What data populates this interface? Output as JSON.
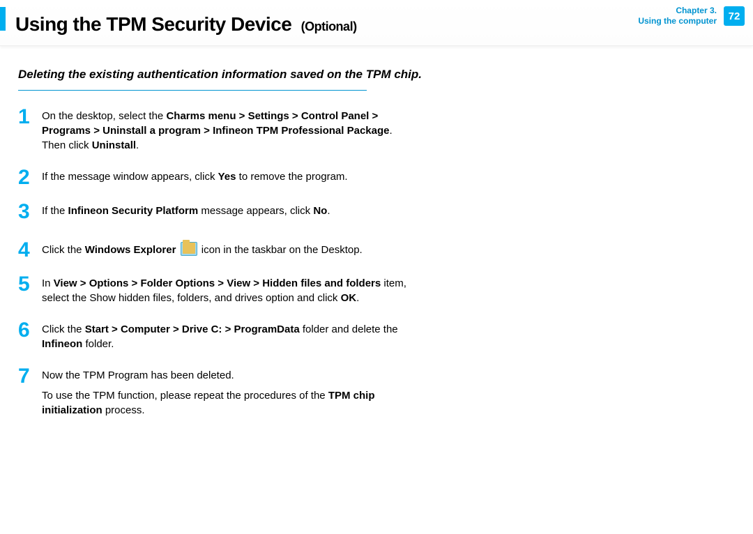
{
  "header": {
    "title_main": "Using the TPM Security Device",
    "title_optional": "(Optional)",
    "chapter_line1": "Chapter 3.",
    "chapter_line2": "Using the computer",
    "page_number": "72"
  },
  "section": {
    "heading": "Deleting the existing authentication information saved on the TPM chip."
  },
  "steps": {
    "s1": {
      "num": "1",
      "t1": "On the desktop, select the ",
      "b1": "Charms menu > Settings > Control Panel  > Programs > Uninstall a program > Infineon TPM Professional Package",
      "t2": ". Then click ",
      "b2": "Uninstall",
      "t3": "."
    },
    "s2": {
      "num": "2",
      "t1": "If the message window appears, click ",
      "b1": "Yes",
      "t2": " to remove the program."
    },
    "s3": {
      "num": "3",
      "t1": "If the ",
      "b1": "Infineon Security Platform",
      "t2": " message appears, click ",
      "b2": "No",
      "t3": "."
    },
    "s4": {
      "num": "4",
      "t1": "Click the ",
      "b1": "Windows Explorer",
      "t2": " icon in the taskbar on the Desktop."
    },
    "s5": {
      "num": "5",
      "t1": "In ",
      "b1": "View > Options > Folder Options > View > Hidden files and folders",
      "t2": " item, select the Show hidden files, folders, and drives option and click ",
      "b2": "OK",
      "t3": "."
    },
    "s6": {
      "num": "6",
      "t1": "Click the ",
      "b1": "Start > Computer > Drive C: > ProgramData",
      "t2": " folder and delete the ",
      "b2": "Infineon",
      "t3": " folder."
    },
    "s7": {
      "num": "7",
      "p1": "Now the TPM Program has been deleted.",
      "p2a": "To use the TPM function, please repeat the procedures of the ",
      "p2b": "TPM chip initialization",
      "p2c": " process."
    }
  }
}
